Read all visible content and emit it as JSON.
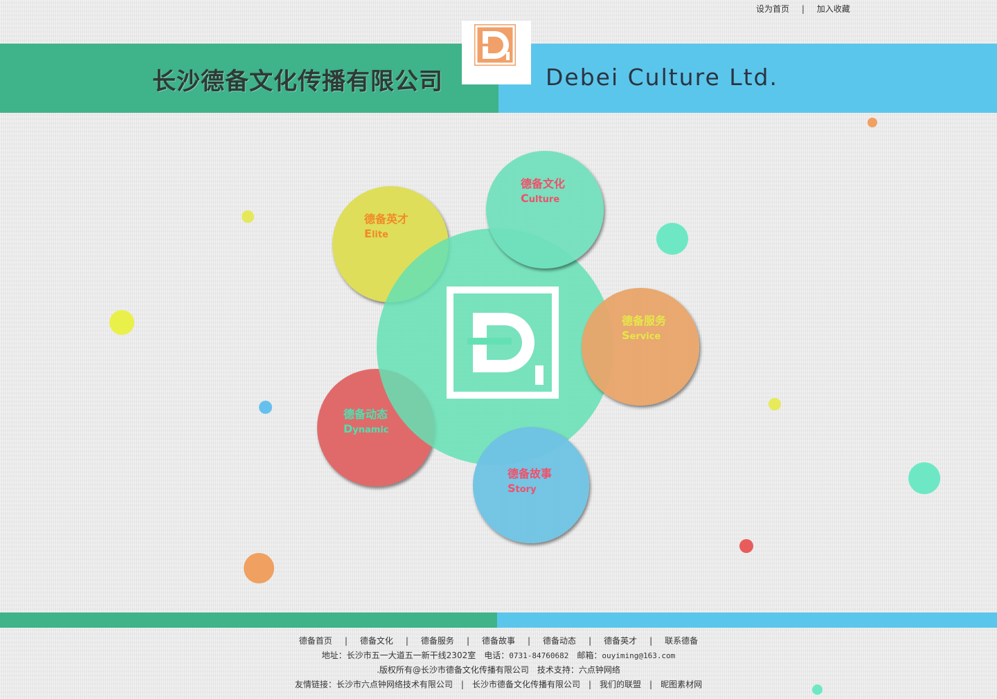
{
  "top_links": {
    "set_home": "设为首页",
    "separator": "|",
    "bookmark": "加入收藏"
  },
  "header": {
    "cn_title": "长沙德备文化传播有限公司",
    "en_title": "Debei Culture Ltd.",
    "logo_letter": "D",
    "colors": {
      "green": "#3fb38a",
      "blue": "#5bc6ec",
      "orange": "#f0a068"
    }
  },
  "nodes": {
    "culture": {
      "cn": "德备文化",
      "en_initial": "C",
      "en_rest": "ulture",
      "color": "#6fe0bb",
      "text_color": "#f0506a"
    },
    "elite": {
      "cn": "德备英才",
      "en_initial": "E",
      "en_rest": "lite",
      "color": "#dede5a",
      "text_color": "#f08a28"
    },
    "service": {
      "cn": "德备服务",
      "en_initial": "S",
      "en_rest": "ervice",
      "color": "#e8a468",
      "text_color": "#e6e64a"
    },
    "dynamic": {
      "cn": "德备动态",
      "en_initial": "D",
      "en_rest": "ynamic",
      "color": "#e06a6a",
      "text_color": "#4ee0b0"
    },
    "story": {
      "cn": "德备故事",
      "en_initial": "S",
      "en_rest": "tory",
      "color": "#6ec2e4",
      "text_color": "#f0506a"
    }
  },
  "footer": {
    "nav": [
      "德备首页",
      "德备文化",
      "德备服务",
      "德备故事",
      "德备动态",
      "德备英才",
      "联系德备"
    ],
    "separator": "|",
    "address_label": "地址：长沙市五一大道五一新干线2302室",
    "phone_label": "电话：",
    "phone": "0731-84760682",
    "email_label": "邮箱：",
    "email": "ouyiming@163.com",
    "copyright": ".版权所有@长沙市德备文化传播有限公司",
    "support": "技术支持：六点钟网络",
    "links_label": "友情链接：",
    "links": [
      "长沙市六点钟网络技术有限公司",
      "长沙市德备文化传播有限公司",
      "我们的联盟",
      "昵图素材网"
    ]
  }
}
